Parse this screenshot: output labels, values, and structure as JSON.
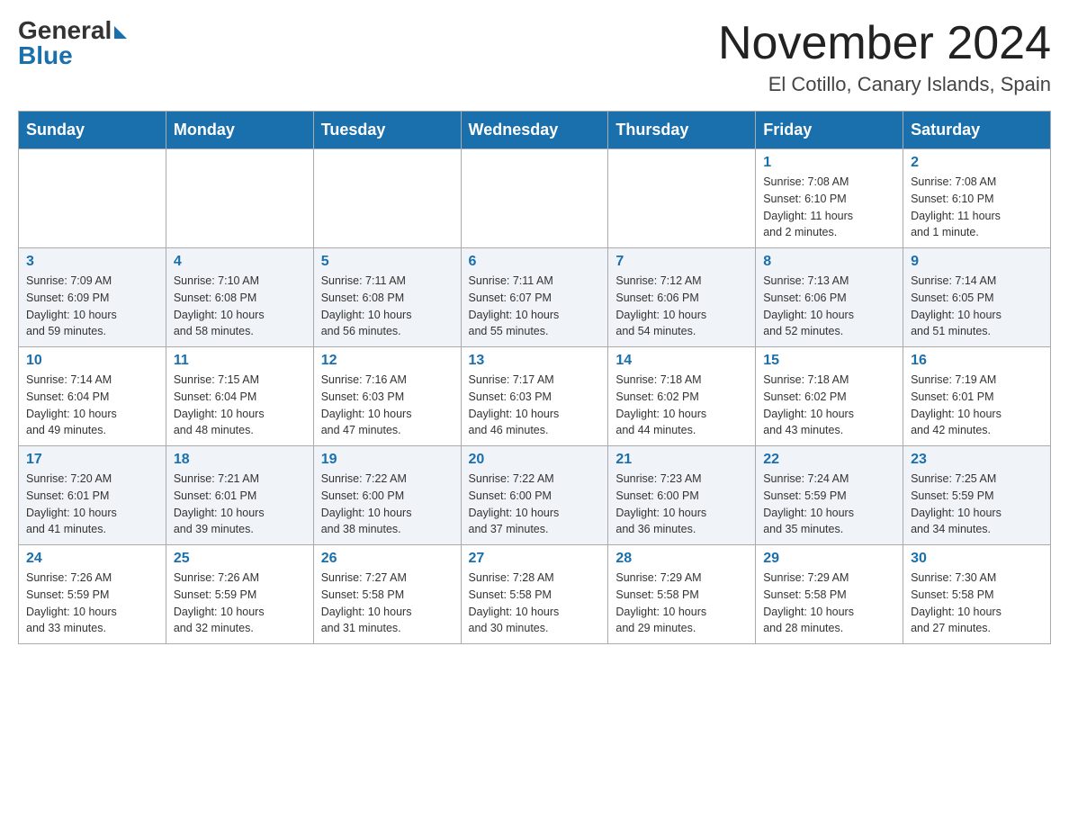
{
  "logo": {
    "general": "General",
    "blue": "Blue"
  },
  "title": "November 2024",
  "location": "El Cotillo, Canary Islands, Spain",
  "weekdays": [
    "Sunday",
    "Monday",
    "Tuesday",
    "Wednesday",
    "Thursday",
    "Friday",
    "Saturday"
  ],
  "weeks": [
    [
      {
        "day": "",
        "info": ""
      },
      {
        "day": "",
        "info": ""
      },
      {
        "day": "",
        "info": ""
      },
      {
        "day": "",
        "info": ""
      },
      {
        "day": "",
        "info": ""
      },
      {
        "day": "1",
        "info": "Sunrise: 7:08 AM\nSunset: 6:10 PM\nDaylight: 11 hours\nand 2 minutes."
      },
      {
        "day": "2",
        "info": "Sunrise: 7:08 AM\nSunset: 6:10 PM\nDaylight: 11 hours\nand 1 minute."
      }
    ],
    [
      {
        "day": "3",
        "info": "Sunrise: 7:09 AM\nSunset: 6:09 PM\nDaylight: 10 hours\nand 59 minutes."
      },
      {
        "day": "4",
        "info": "Sunrise: 7:10 AM\nSunset: 6:08 PM\nDaylight: 10 hours\nand 58 minutes."
      },
      {
        "day": "5",
        "info": "Sunrise: 7:11 AM\nSunset: 6:08 PM\nDaylight: 10 hours\nand 56 minutes."
      },
      {
        "day": "6",
        "info": "Sunrise: 7:11 AM\nSunset: 6:07 PM\nDaylight: 10 hours\nand 55 minutes."
      },
      {
        "day": "7",
        "info": "Sunrise: 7:12 AM\nSunset: 6:06 PM\nDaylight: 10 hours\nand 54 minutes."
      },
      {
        "day": "8",
        "info": "Sunrise: 7:13 AM\nSunset: 6:06 PM\nDaylight: 10 hours\nand 52 minutes."
      },
      {
        "day": "9",
        "info": "Sunrise: 7:14 AM\nSunset: 6:05 PM\nDaylight: 10 hours\nand 51 minutes."
      }
    ],
    [
      {
        "day": "10",
        "info": "Sunrise: 7:14 AM\nSunset: 6:04 PM\nDaylight: 10 hours\nand 49 minutes."
      },
      {
        "day": "11",
        "info": "Sunrise: 7:15 AM\nSunset: 6:04 PM\nDaylight: 10 hours\nand 48 minutes."
      },
      {
        "day": "12",
        "info": "Sunrise: 7:16 AM\nSunset: 6:03 PM\nDaylight: 10 hours\nand 47 minutes."
      },
      {
        "day": "13",
        "info": "Sunrise: 7:17 AM\nSunset: 6:03 PM\nDaylight: 10 hours\nand 46 minutes."
      },
      {
        "day": "14",
        "info": "Sunrise: 7:18 AM\nSunset: 6:02 PM\nDaylight: 10 hours\nand 44 minutes."
      },
      {
        "day": "15",
        "info": "Sunrise: 7:18 AM\nSunset: 6:02 PM\nDaylight: 10 hours\nand 43 minutes."
      },
      {
        "day": "16",
        "info": "Sunrise: 7:19 AM\nSunset: 6:01 PM\nDaylight: 10 hours\nand 42 minutes."
      }
    ],
    [
      {
        "day": "17",
        "info": "Sunrise: 7:20 AM\nSunset: 6:01 PM\nDaylight: 10 hours\nand 41 minutes."
      },
      {
        "day": "18",
        "info": "Sunrise: 7:21 AM\nSunset: 6:01 PM\nDaylight: 10 hours\nand 39 minutes."
      },
      {
        "day": "19",
        "info": "Sunrise: 7:22 AM\nSunset: 6:00 PM\nDaylight: 10 hours\nand 38 minutes."
      },
      {
        "day": "20",
        "info": "Sunrise: 7:22 AM\nSunset: 6:00 PM\nDaylight: 10 hours\nand 37 minutes."
      },
      {
        "day": "21",
        "info": "Sunrise: 7:23 AM\nSunset: 6:00 PM\nDaylight: 10 hours\nand 36 minutes."
      },
      {
        "day": "22",
        "info": "Sunrise: 7:24 AM\nSunset: 5:59 PM\nDaylight: 10 hours\nand 35 minutes."
      },
      {
        "day": "23",
        "info": "Sunrise: 7:25 AM\nSunset: 5:59 PM\nDaylight: 10 hours\nand 34 minutes."
      }
    ],
    [
      {
        "day": "24",
        "info": "Sunrise: 7:26 AM\nSunset: 5:59 PM\nDaylight: 10 hours\nand 33 minutes."
      },
      {
        "day": "25",
        "info": "Sunrise: 7:26 AM\nSunset: 5:59 PM\nDaylight: 10 hours\nand 32 minutes."
      },
      {
        "day": "26",
        "info": "Sunrise: 7:27 AM\nSunset: 5:58 PM\nDaylight: 10 hours\nand 31 minutes."
      },
      {
        "day": "27",
        "info": "Sunrise: 7:28 AM\nSunset: 5:58 PM\nDaylight: 10 hours\nand 30 minutes."
      },
      {
        "day": "28",
        "info": "Sunrise: 7:29 AM\nSunset: 5:58 PM\nDaylight: 10 hours\nand 29 minutes."
      },
      {
        "day": "29",
        "info": "Sunrise: 7:29 AM\nSunset: 5:58 PM\nDaylight: 10 hours\nand 28 minutes."
      },
      {
        "day": "30",
        "info": "Sunrise: 7:30 AM\nSunset: 5:58 PM\nDaylight: 10 hours\nand 27 minutes."
      }
    ]
  ]
}
